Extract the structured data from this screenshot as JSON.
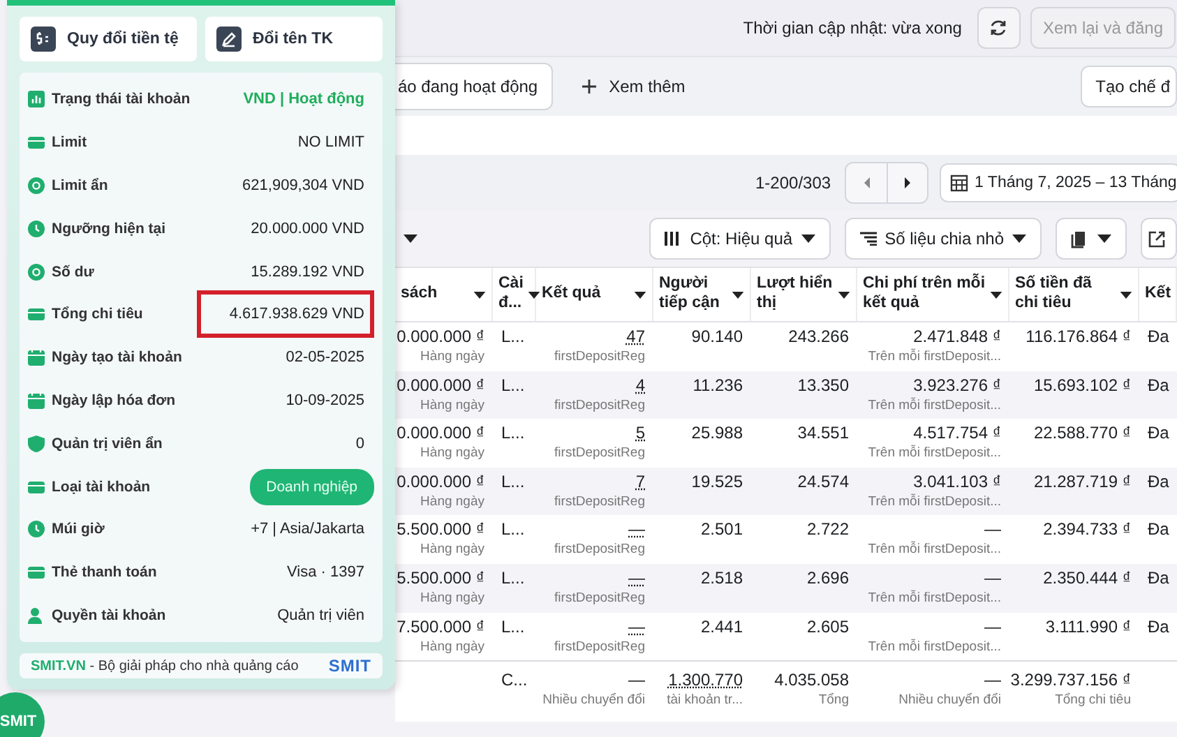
{
  "topbar": {
    "update_text": "Thời gian cập nhật: vừa xong",
    "review_button": "Xem lại và đăng"
  },
  "filters": {
    "active_filter": "áo đang hoạt động",
    "more_button": "Xem thêm",
    "create_button": "Tạo chế đ"
  },
  "pager": {
    "range": "1-200/303",
    "date_range": "1 Tháng 7, 2025 – 13 Tháng"
  },
  "toolbar": {
    "columns_button": "Cột: Hiệu quả",
    "breakdown_button": "Số liệu chia nhỏ"
  },
  "table": {
    "columns": [
      {
        "label": "sách",
        "sortable": true
      },
      {
        "label": "Cài đ...",
        "sortable": true
      },
      {
        "label": "Kết quả",
        "sortable": true
      },
      {
        "label": "Người tiếp cận",
        "sortable": true
      },
      {
        "label": "Lượt hiển thị",
        "sortable": true
      },
      {
        "label": "Chi phí trên mỗi kết quả",
        "sortable": true
      },
      {
        "label": "Số tiền đã chi tiêu",
        "sortable": true
      },
      {
        "label": "Kết",
        "sortable": false
      }
    ],
    "rows": [
      {
        "cells": [
          {
            "value": "0.000.000 ₫",
            "sub": "Hàng ngày"
          },
          {
            "value": "L..."
          },
          {
            "value": "47",
            "sub": "firstDepositReg"
          },
          {
            "value": "90.140"
          },
          {
            "value": "243.266"
          },
          {
            "value": "2.471.848 ₫",
            "sub": "Trên mỗi firstDeposit..."
          },
          {
            "value": "116.176.864 ₫"
          },
          {
            "value": "Đa"
          }
        ]
      },
      {
        "cells": [
          {
            "value": "0.000.000 ₫",
            "sub": "Hàng ngày"
          },
          {
            "value": "L..."
          },
          {
            "value": "4",
            "sub": "firstDepositReg"
          },
          {
            "value": "11.236"
          },
          {
            "value": "13.350"
          },
          {
            "value": "3.923.276 ₫",
            "sub": "Trên mỗi firstDeposit..."
          },
          {
            "value": "15.693.102 ₫"
          },
          {
            "value": "Đa"
          }
        ]
      },
      {
        "cells": [
          {
            "value": "0.000.000 ₫",
            "sub": "Hàng ngày"
          },
          {
            "value": "L..."
          },
          {
            "value": "5",
            "sub": "firstDepositReg"
          },
          {
            "value": "25.988"
          },
          {
            "value": "34.551"
          },
          {
            "value": "4.517.754 ₫",
            "sub": "Trên mỗi firstDeposit..."
          },
          {
            "value": "22.588.770 ₫"
          },
          {
            "value": "Đa"
          }
        ]
      },
      {
        "cells": [
          {
            "value": "0.000.000 ₫",
            "sub": "Hàng ngày"
          },
          {
            "value": "L..."
          },
          {
            "value": "7",
            "sub": "firstDepositReg"
          },
          {
            "value": "19.525"
          },
          {
            "value": "24.574"
          },
          {
            "value": "3.041.103 ₫",
            "sub": "Trên mỗi firstDeposit..."
          },
          {
            "value": "21.287.719 ₫"
          },
          {
            "value": "Đa"
          }
        ]
      },
      {
        "cells": [
          {
            "value": "5.500.000 ₫",
            "sub": "Hàng ngày"
          },
          {
            "value": "L..."
          },
          {
            "value": "—",
            "sub": "firstDepositReg"
          },
          {
            "value": "2.501"
          },
          {
            "value": "2.722"
          },
          {
            "value": "—",
            "sub": "Trên mỗi firstDeposit..."
          },
          {
            "value": "2.394.733 ₫"
          },
          {
            "value": "Đa"
          }
        ]
      },
      {
        "cells": [
          {
            "value": "5.500.000 ₫",
            "sub": "Hàng ngày"
          },
          {
            "value": "L..."
          },
          {
            "value": "—",
            "sub": "firstDepositReg"
          },
          {
            "value": "2.518"
          },
          {
            "value": "2.696"
          },
          {
            "value": "—",
            "sub": "Trên mỗi firstDeposit..."
          },
          {
            "value": "2.350.444 ₫"
          },
          {
            "value": "Đa"
          }
        ]
      },
      {
        "cells": [
          {
            "value": "7.500.000 ₫",
            "sub": "Hàng ngày"
          },
          {
            "value": "L..."
          },
          {
            "value": "—",
            "sub": "firstDepositReg"
          },
          {
            "value": "2.441"
          },
          {
            "value": "2.605"
          },
          {
            "value": "—",
            "sub": "Trên mỗi firstDeposit..."
          },
          {
            "value": "3.111.990 ₫"
          },
          {
            "value": "Đa"
          }
        ]
      }
    ],
    "totals": [
      {
        "value": "C..."
      },
      {
        "value": "—",
        "sub": "Nhiều chuyển đổi"
      },
      {
        "value": "1.300.770",
        "sub": "tài khoản tr..."
      },
      {
        "value": "4.035.058",
        "sub": "Tổng"
      },
      {
        "value": "—",
        "sub": "Nhiều chuyển đổi"
      },
      {
        "value": "3.299.737.156 ₫",
        "sub": "Tổng chi tiêu"
      }
    ]
  },
  "panel": {
    "buttons": [
      {
        "label": "Quy đổi tiền tệ"
      },
      {
        "label": "Đổi tên TK"
      }
    ],
    "rows": [
      {
        "label": "Trạng thái tài khoản",
        "value": "VND | Hoạt động",
        "kind": "status",
        "highlighted": false
      },
      {
        "label": "Limit",
        "value": "NO LIMIT",
        "kind": "text",
        "highlighted": false
      },
      {
        "label": "Limit ẩn",
        "value": "621,909,304 VND",
        "kind": "text",
        "highlighted": false
      },
      {
        "label": "Ngưỡng hiện tại",
        "value": "20.000.000 VND",
        "kind": "text",
        "highlighted": false
      },
      {
        "label": "Số dư",
        "value": "15.289.192 VND",
        "kind": "text",
        "highlighted": false
      },
      {
        "label": "Tổng chi tiêu",
        "value": "4.617.938.629 VND",
        "kind": "text",
        "highlighted": true
      },
      {
        "label": "Ngày tạo tài khoản",
        "value": "02-05-2025",
        "kind": "text",
        "highlighted": false
      },
      {
        "label": "Ngày lập hóa đơn",
        "value": "10-09-2025",
        "kind": "text",
        "highlighted": false
      },
      {
        "label": "Quản trị viên ẩn",
        "value": "0",
        "kind": "text",
        "highlighted": false
      },
      {
        "label": "Loại tài khoản",
        "value": "Doanh nghiệp",
        "kind": "badge",
        "highlighted": false
      },
      {
        "label": "Múi giờ",
        "value": "+7 | Asia/Jakarta",
        "kind": "text",
        "highlighted": false
      },
      {
        "label": "Thẻ thanh toán",
        "value": "Visa · 1397",
        "kind": "text",
        "highlighted": false
      },
      {
        "label": "Quyền tài khoản",
        "value": "Quản trị viên",
        "kind": "text",
        "highlighted": false
      }
    ],
    "footer": {
      "brand": "SMIT.VN",
      "text": " - Bộ giải pháp cho nhà quảng cáo",
      "logo": "SMIT"
    }
  },
  "floating_logo": "SMIT"
}
